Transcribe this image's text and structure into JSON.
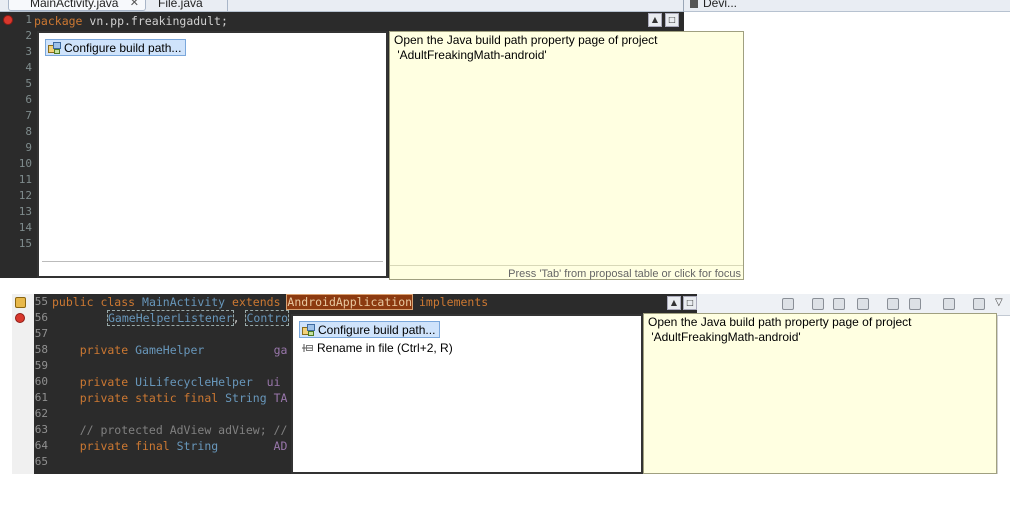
{
  "top": {
    "tabs": [
      {
        "label": "MainActivity.java",
        "close": "✕"
      },
      {
        "label": "File.java"
      }
    ],
    "devices_tab": "Devi...",
    "line_numbers": [
      "1",
      "2",
      "3",
      "4",
      "5",
      "6",
      "7",
      "8",
      "9",
      "10",
      "11",
      "12",
      "13",
      "14",
      "15"
    ],
    "code_line1": {
      "keyword": "package",
      "rest": " vn.pp.freakingadult;"
    },
    "popup": {
      "items": [
        {
          "label": "Configure build path...",
          "icon": "build-path-icon",
          "selected": true
        }
      ],
      "info_line1": "Open the Java build path property page of project",
      "info_line2": " 'AdultFreakingMath-android'",
      "footer": "Press 'Tab' from proposal table or click for focus"
    }
  },
  "bottom": {
    "line_numbers": [
      "55",
      "56",
      "57",
      "58",
      "59",
      "60",
      "61",
      "62",
      "63",
      "64",
      "65"
    ],
    "code": {
      "l55_a": "public class ",
      "l55_b": "MainActivity",
      "l55_c": " extends ",
      "l55_d": "AndroidApplication",
      "l55_e": " implements",
      "l56_a": "GameHelperListener",
      "l56_b": ", ",
      "l56_c": "Contro",
      "l58_a": "    private ",
      "l58_b": "GameHelper",
      "l58_c": "          ga",
      "l60_a": "    private ",
      "l60_b": "UiLifecycleHelper",
      "l60_c": "  ui",
      "l61_a": "    private static final ",
      "l61_b": "String",
      "l61_c": " TA",
      "l63": "    // protected AdView adView; //",
      "l64_a": "    private final ",
      "l64_b": "String",
      "l64_c": "        AD"
    },
    "popup": {
      "items": [
        {
          "label": "Configure build path...",
          "icon": "build-path-icon",
          "selected": true
        },
        {
          "label": "Rename in file (Ctrl+2, R)",
          "icon": "rename-icon",
          "selected": false
        }
      ],
      "info_line1": "Open the Java build path property page of project",
      "info_line2": " 'AdultFreakingMath-android'"
    }
  },
  "colors": {
    "editor_bg": "#2b2b2b",
    "keyword": "#cc7832",
    "info_bg": "#ffffe1",
    "selection": "#cfe3fb",
    "error": "#d9382d"
  }
}
